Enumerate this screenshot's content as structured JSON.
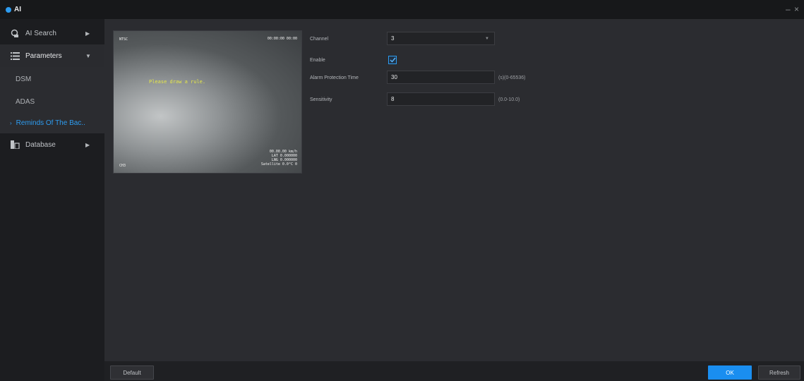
{
  "window": {
    "title": "AI",
    "controls": "– ×"
  },
  "sidebar": {
    "items": [
      {
        "label": "AI Search",
        "icon": "ai-search-icon"
      },
      {
        "label": "Parameters",
        "icon": "list-icon"
      },
      {
        "label": "Database",
        "icon": "database-icon"
      }
    ],
    "sub_items": [
      {
        "label": "DSM"
      },
      {
        "label": "ADAS"
      },
      {
        "label": "Reminds Of The Bac.."
      }
    ]
  },
  "video": {
    "top_left": "NTSC",
    "top_right": "00:00:00 00:00",
    "bottom_left": "CH3",
    "bottom_right": "00.00.00 km/h\nLAT 0.000000\nLNG 0.000000\nSatellite 0.0°C 0",
    "prompt": "Please draw a rule."
  },
  "form": {
    "channel_label": "Channel",
    "channel_value": "3",
    "enable_label": "Enable",
    "alarm_label": "Alarm Protection Time",
    "alarm_value": "30",
    "alarm_hint": "(s)(0-65536)",
    "sensitivity_label": "Sensitivity",
    "sensitivity_value": "8",
    "sensitivity_hint": "(0.0-10.0)"
  },
  "buttons": {
    "default": "Default",
    "ok": "OK",
    "refresh": "Refresh"
  },
  "colors": {
    "accent": "#1a8ef0",
    "active_text": "#2d9cf0"
  }
}
